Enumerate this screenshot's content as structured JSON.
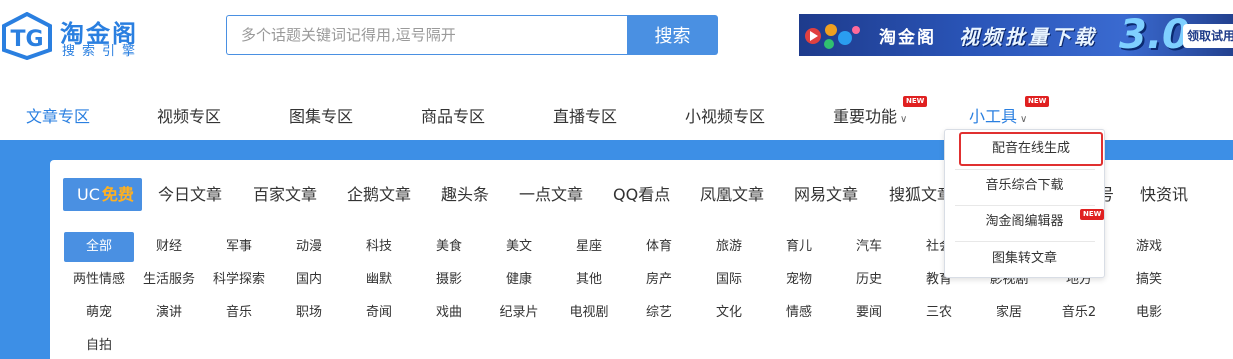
{
  "header": {
    "logo_name": "淘金阁",
    "logo_sub": "搜索引擎",
    "search_placeholder": "多个话题关键词记得用,逗号隔开",
    "search_button": "搜索"
  },
  "banner": {
    "brand": "淘金阁",
    "headline": "视频批量下载",
    "version": "3.0",
    "cta": "领取试用"
  },
  "nav": {
    "items": [
      {
        "label": "文章专区",
        "active": true
      },
      {
        "label": "视频专区"
      },
      {
        "label": "图集专区"
      },
      {
        "label": "商品专区"
      },
      {
        "label": "直播专区"
      },
      {
        "label": "小视频专区"
      },
      {
        "label": "重要功能",
        "badge": "NEW"
      },
      {
        "label": "小工具",
        "badge": "NEW"
      }
    ]
  },
  "sources": {
    "items": [
      {
        "label": "UC",
        "suffix": "免费",
        "active": true
      },
      {
        "label": "今日文章"
      },
      {
        "label": "百家文章"
      },
      {
        "label": "企鹅文章"
      },
      {
        "label": "趣头条"
      },
      {
        "label": "一点文章"
      },
      {
        "label": "QQ看点"
      },
      {
        "label": "凤凰文章"
      },
      {
        "label": "网易文章"
      },
      {
        "label": "搜狐文章"
      },
      {
        "label": "号"
      },
      {
        "label": "快资讯"
      }
    ]
  },
  "categories": {
    "rows": [
      [
        "全部",
        "财经",
        "军事",
        "动漫",
        "科技",
        "美食",
        "美文",
        "星座",
        "体育",
        "旅游",
        "育儿",
        "汽车",
        "社会",
        "",
        "",
        "游戏"
      ],
      [
        "两性情感",
        "生活服务",
        "科学探索",
        "国内",
        "幽默",
        "摄影",
        "健康",
        "其他",
        "房产",
        "国际",
        "宠物",
        "历史",
        "教育",
        "影视剧",
        "地方",
        "搞笑"
      ],
      [
        "萌宠",
        "演讲",
        "音乐",
        "职场",
        "奇闻",
        "戏曲",
        "纪录片",
        "电视剧",
        "综艺",
        "文化",
        "情感",
        "要闻",
        "三农",
        "家居",
        "音乐2",
        "电影"
      ],
      [
        "自拍"
      ]
    ]
  },
  "dropdown": {
    "items": [
      {
        "label": "配音在线生成",
        "highlighted": true
      },
      {
        "label": "音乐综合下载"
      },
      {
        "label": "淘金阁编辑器",
        "badge": "NEW"
      },
      {
        "label": "图集转文章"
      }
    ]
  },
  "colors": {
    "accent": "#4a90e2",
    "blue_bg": "#3d8fe6",
    "badge_red": "#e02020",
    "free_orange": "#ffb020",
    "highlight_border": "#e03030"
  }
}
